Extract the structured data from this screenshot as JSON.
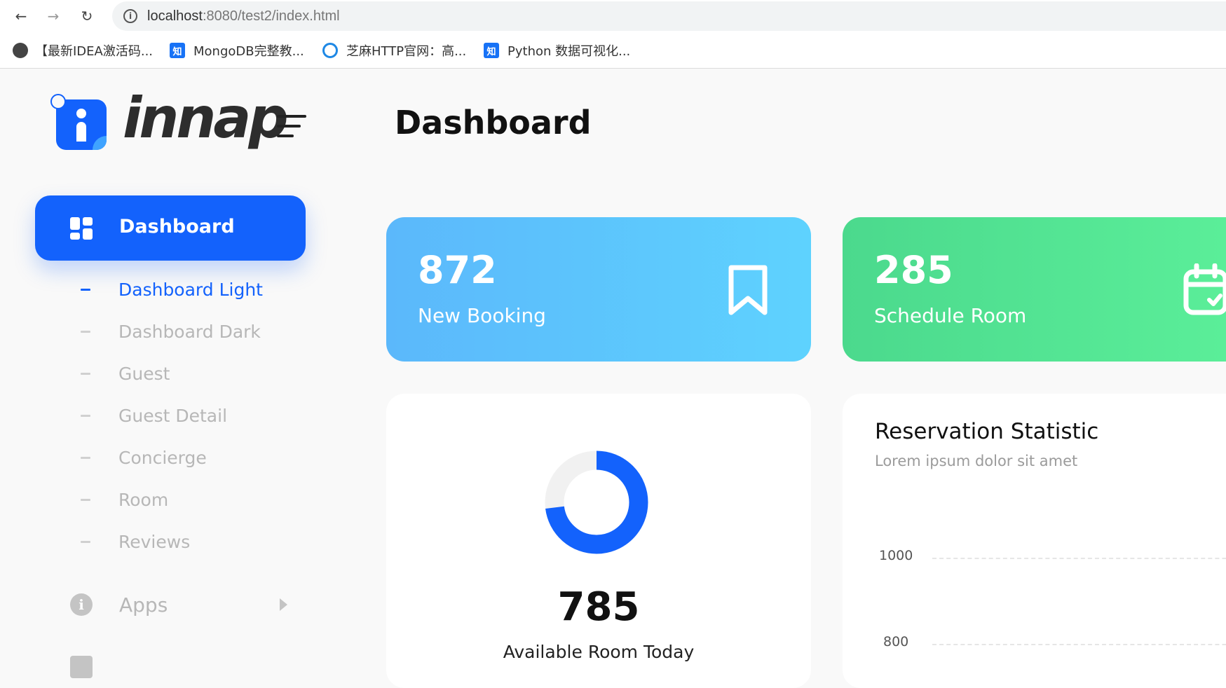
{
  "browser": {
    "url_host": "localhost",
    "url_rest": ":8080/test2/index.html",
    "bookmarks": [
      {
        "label": "【最新IDEA激活码...",
        "icon": "globe-icon"
      },
      {
        "label": "MongoDB完整教...",
        "icon": "zhihu-icon",
        "icon_text": "知"
      },
      {
        "label": "芝麻HTTP官网：高...",
        "icon": "ring-icon"
      },
      {
        "label": "Python 数据可视化...",
        "icon": "zhihu-icon",
        "icon_text": "知"
      }
    ]
  },
  "brand": {
    "name": "innap",
    "accent": "#1362fc"
  },
  "sidebar": {
    "active": {
      "label": "Dashboard",
      "icon": "dashboard-grid-icon"
    },
    "subitems": [
      {
        "label": "Dashboard Light",
        "active": true
      },
      {
        "label": "Dashboard Dark"
      },
      {
        "label": "Guest"
      },
      {
        "label": "Guest Detail"
      },
      {
        "label": "Concierge"
      },
      {
        "label": "Room"
      },
      {
        "label": "Reviews"
      }
    ],
    "groups": [
      {
        "label": "Apps",
        "icon": "info-icon",
        "icon_text": "i"
      }
    ]
  },
  "header": {
    "title": "Dashboard"
  },
  "stats": [
    {
      "value": "872",
      "label": "New Booking",
      "icon": "bookmark-icon",
      "color": "#5bc4fd"
    },
    {
      "value": "285",
      "label": "Schedule Room",
      "icon": "calendar-check-icon",
      "color": "#52e394"
    }
  ],
  "available": {
    "value": "785",
    "label": "Available Room Today",
    "donut_fraction": 0.73
  },
  "reservation": {
    "title": "Reservation Statistic",
    "subtitle": "Lorem ipsum dolor sit amet",
    "y_ticks": [
      "1000",
      "800"
    ]
  }
}
